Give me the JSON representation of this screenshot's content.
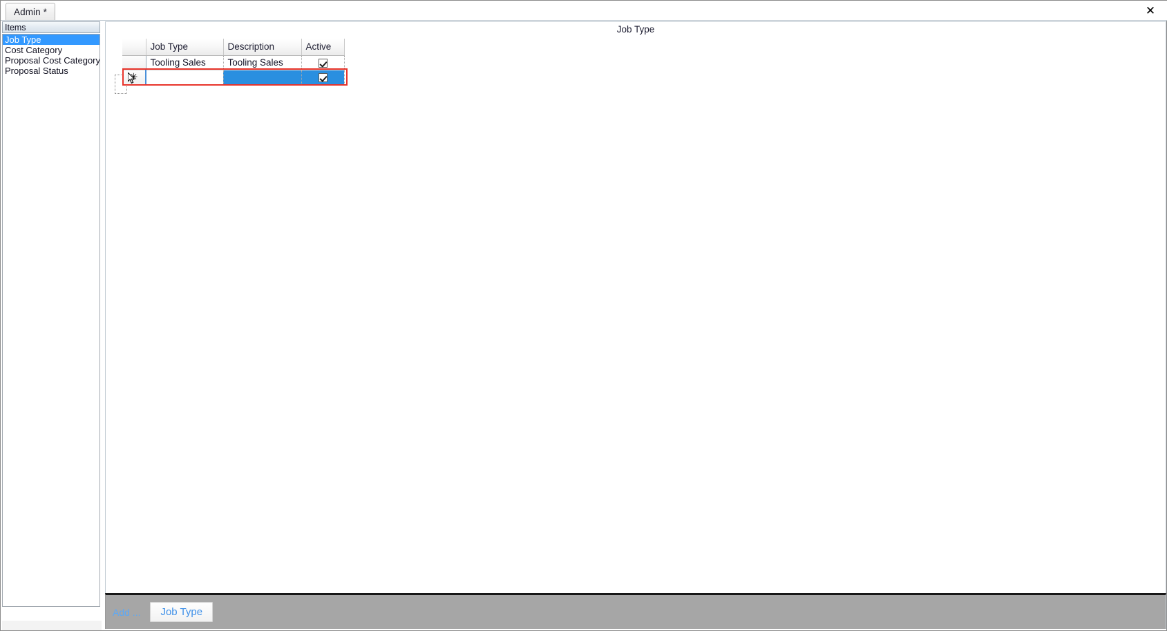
{
  "window": {
    "close_icon": "close-icon",
    "close_glyph": "✕"
  },
  "tabs": [
    {
      "label": "Admin *",
      "active": true
    }
  ],
  "sidebar": {
    "header": "Items",
    "items": [
      {
        "label": "Job Type",
        "selected": true
      },
      {
        "label": "Cost Category",
        "selected": false
      },
      {
        "label": "Proposal Cost Category",
        "selected": false
      },
      {
        "label": "Proposal Status",
        "selected": false
      }
    ]
  },
  "content": {
    "title": "Job Type"
  },
  "grid": {
    "columns": [
      {
        "key": "rowsel",
        "label": ""
      },
      {
        "key": "jobtype",
        "label": "Job Type"
      },
      {
        "key": "description",
        "label": "Description"
      },
      {
        "key": "active",
        "label": "Active"
      }
    ],
    "rows": [
      {
        "marker": "",
        "jobtype": "Tooling Sales",
        "description": "Tooling Sales",
        "active": true,
        "state": "normal"
      },
      {
        "marker": "✳",
        "jobtype": "",
        "description": "",
        "active": true,
        "state": "new-row-editing"
      }
    ]
  },
  "bottom_bar": {
    "add_label": "Add ...",
    "buttons": [
      {
        "label": "Job Type"
      }
    ]
  },
  "colors": {
    "selection_blue": "#3399ff",
    "cell_selection_blue": "#2a8fe0",
    "annotation_red": "#e8332a",
    "bottom_bar_gray": "#a6a6a6",
    "link_blue": "#3d8fe8"
  }
}
